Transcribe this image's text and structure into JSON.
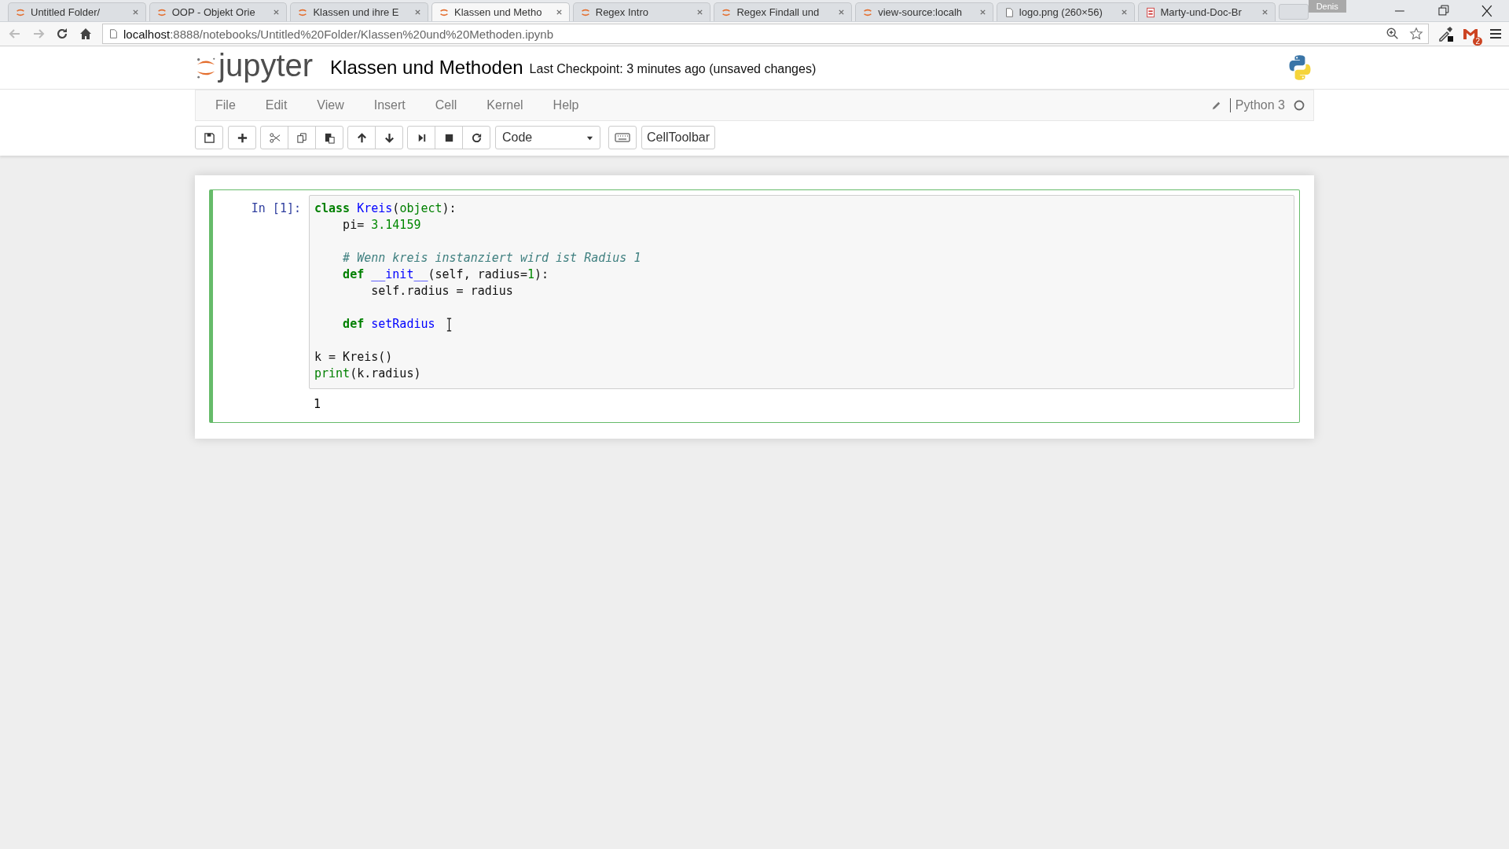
{
  "browser": {
    "tabs": [
      {
        "title": "Untitled Folder/",
        "kind": "jupyter",
        "selected": false
      },
      {
        "title": "OOP - Objekt Orie",
        "kind": "jupyter",
        "selected": false
      },
      {
        "title": "Klassen und ihre E",
        "kind": "jupyter",
        "selected": false
      },
      {
        "title": "Klassen und Metho",
        "kind": "jupyter",
        "selected": true
      },
      {
        "title": "Regex Intro",
        "kind": "jupyter",
        "selected": false
      },
      {
        "title": "Regex Findall und",
        "kind": "jupyter",
        "selected": false
      },
      {
        "title": "view-source:localh",
        "kind": "jupyter",
        "selected": false
      },
      {
        "title": "logo.png (260×56)",
        "kind": "file",
        "selected": false
      },
      {
        "title": "Marty-und-Doc-Br",
        "kind": "pdf",
        "selected": false
      }
    ],
    "profile": "Denis",
    "url_host": "localhost",
    "url_rest": ":8888/notebooks/Untitled%20Folder/Klassen%20und%20Methoden.ipynb",
    "mail_badge": "2"
  },
  "notebook": {
    "title": "Klassen und Methoden",
    "checkpoint": "Last Checkpoint: 3 minutes ago (unsaved changes)",
    "menu": [
      "File",
      "Edit",
      "View",
      "Insert",
      "Cell",
      "Kernel",
      "Help"
    ],
    "kernel": "Python 3",
    "cell_type": "Code",
    "celltoolbar": "CellToolbar",
    "cells": [
      {
        "prompt": "In [1]:",
        "selected": true,
        "lines": [
          {
            "tokens": [
              {
                "t": "class",
                "kind": "keyword"
              },
              {
                "t": " Kreis",
                "kind": "name"
              },
              {
                "t": "(",
                "kind": "plain"
              },
              {
                "t": "object",
                "kind": "builtin"
              },
              {
                "t": "):",
                "kind": "plain"
              }
            ]
          },
          {
            "tokens": [
              {
                "t": "    pi=",
                "kind": "plain"
              },
              {
                "t": " 3.14159",
                "kind": "number"
              }
            ],
            "blank_after": true
          },
          {
            "tokens": [
              {
                "t": "    # Wenn kreis instanziert wird ist Radius 1",
                "kind": "comment"
              }
            ]
          },
          {
            "tokens": [
              {
                "t": "    def",
                "kind": "keyword"
              },
              {
                "t": " __init__",
                "kind": "name"
              },
              {
                "t": "(self, radius=",
                "kind": "plain"
              },
              {
                "t": "1",
                "kind": "number"
              },
              {
                "t": "):",
                "kind": "plain"
              }
            ]
          },
          {
            "tokens": [
              {
                "t": "        self.radius = radius",
                "kind": "plain"
              }
            ],
            "blank_after": true
          },
          {
            "tokens": [
              {
                "t": "    def",
                "kind": "keyword"
              },
              {
                "t": " setRadius",
                "kind": "name"
              }
            ],
            "mouse_cursor": true,
            "blank_after": true
          },
          {
            "tokens": [
              {
                "t": "k = Kreis()",
                "kind": "plain"
              }
            ]
          },
          {
            "tokens": [
              {
                "t": "print",
                "kind": "builtin"
              },
              {
                "t": "(k.radius)",
                "kind": "plain"
              }
            ]
          }
        ],
        "output": "1"
      }
    ]
  }
}
